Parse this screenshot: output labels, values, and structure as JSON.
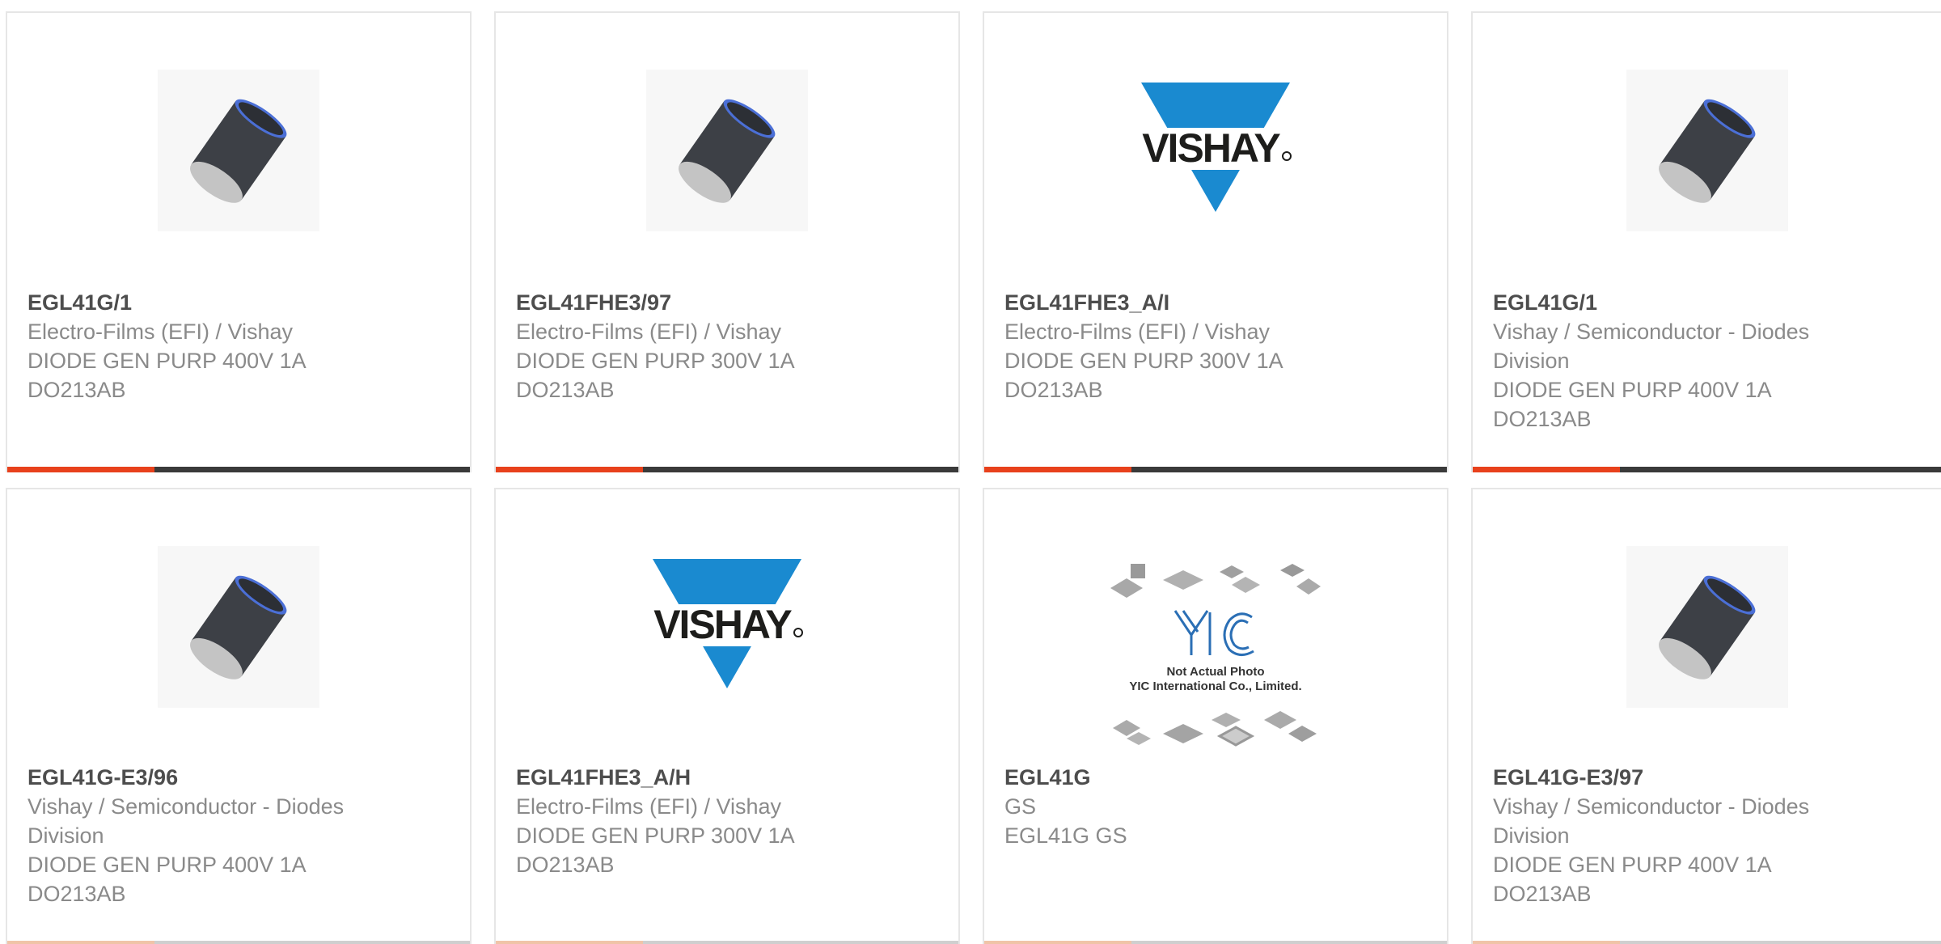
{
  "products": [
    {
      "part": "EGL41G/1",
      "maker": "Electro-Films (EFI) / Vishay",
      "desc": "DIODE GEN PURP 400V 1A",
      "pkg": "DO213AB",
      "image": "diode-cylinder-icon"
    },
    {
      "part": "EGL41FHE3/97",
      "maker": "Electro-Films (EFI) / Vishay",
      "desc": "DIODE GEN PURP 300V 1A",
      "pkg": "DO213AB",
      "image": "diode-cylinder-icon"
    },
    {
      "part": "EGL41FHE3_A/I",
      "maker": "Electro-Films (EFI) / Vishay",
      "desc": "DIODE GEN PURP 300V 1A",
      "pkg": "DO213AB",
      "image": "vishay-logo",
      "logo_text": "VISHAY"
    },
    {
      "part": "EGL41G/1",
      "maker": "Vishay / Semiconductor - Diodes Division",
      "desc": "DIODE GEN PURP 400V 1A",
      "pkg": "DO213AB",
      "image": "diode-cylinder-icon"
    },
    {
      "part": "EGL41G-E3/96",
      "maker": "Vishay / Semiconductor - Diodes Division",
      "desc": "DIODE GEN PURP 400V 1A",
      "pkg": "DO213AB",
      "image": "diode-cylinder-icon"
    },
    {
      "part": "EGL41FHE3_A/H",
      "maker": "Electro-Films (EFI) / Vishay",
      "desc": "DIODE GEN PURP 300V 1A",
      "pkg": "DO213AB",
      "image": "vishay-logo",
      "logo_text": "VISHAY"
    },
    {
      "part": "EGL41G",
      "maker": "GS",
      "desc": "EGL41G GS",
      "pkg": "",
      "image": "yic-placeholder",
      "logo_text": "YIC",
      "caption1": "Not Actual Photo",
      "caption2": "YIC International Co., Limited."
    },
    {
      "part": "EGL41G-E3/97",
      "maker": "Vishay / Semiconductor - Diodes Division",
      "desc": "DIODE GEN PURP 400V 1A",
      "pkg": "DO213AB",
      "image": "diode-cylinder-icon"
    }
  ],
  "colors": {
    "accent": "#e8411c",
    "bar": "#3a3a3a",
    "vishay_blue": "#1a8ad0",
    "text": "#8a8a8a",
    "title": "#4d4d4d"
  }
}
